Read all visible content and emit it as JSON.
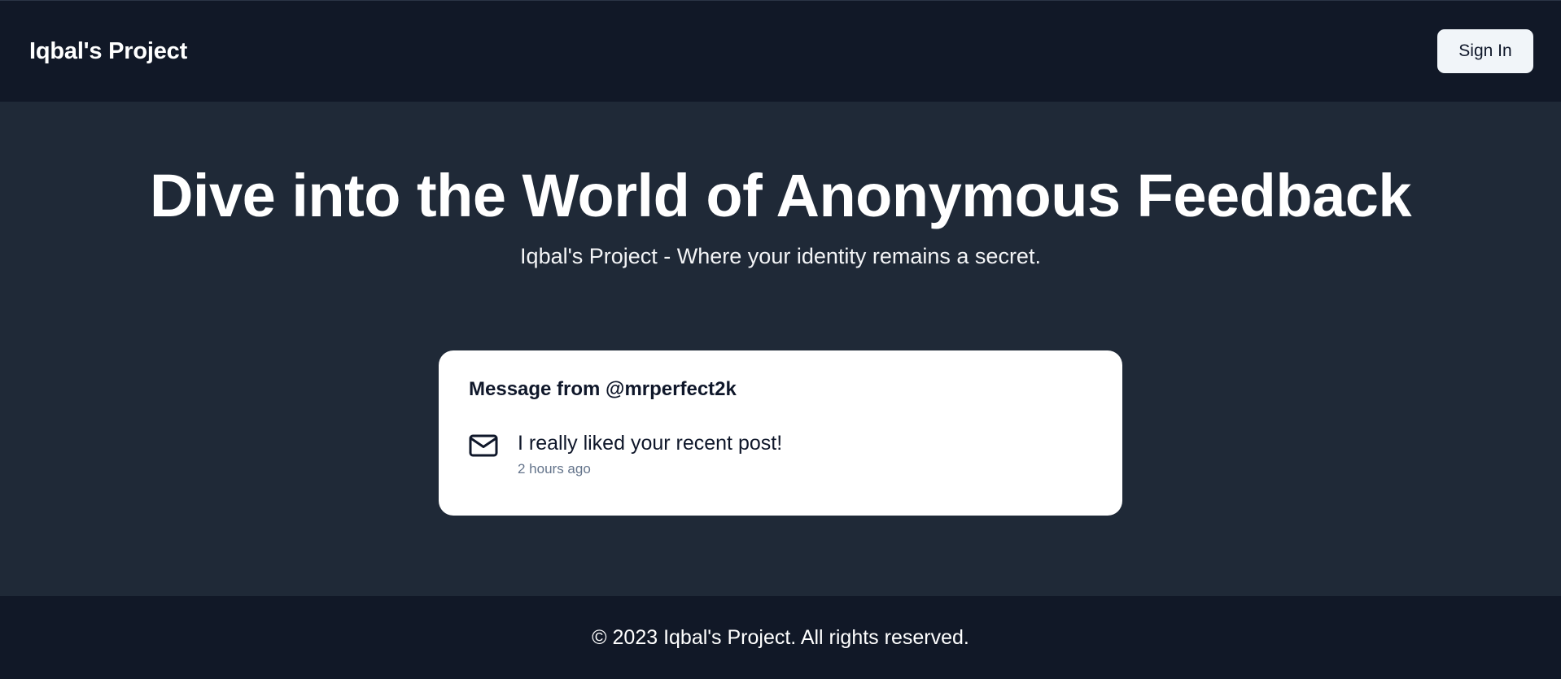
{
  "header": {
    "brand": "Iqbal's Project",
    "signin_label": "Sign In"
  },
  "hero": {
    "title": "Dive into the World of Anonymous Feedback",
    "subtitle": "Iqbal's Project - Where your identity remains a secret."
  },
  "message_card": {
    "title": "Message from @mrperfect2k",
    "icon": "mail-icon",
    "text": "I really liked your recent post!",
    "time": "2 hours ago"
  },
  "footer": {
    "text": "© 2023 Iqbal's Project. All rights reserved."
  },
  "colors": {
    "nav_bg": "#111827",
    "main_bg": "#1f2937",
    "card_bg": "#ffffff",
    "button_bg": "#f1f5f9",
    "muted_text": "#64748b"
  }
}
